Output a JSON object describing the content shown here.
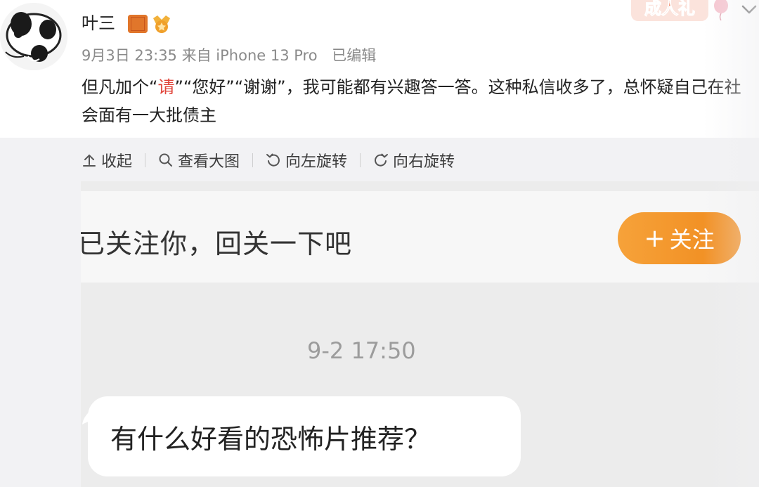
{
  "post": {
    "author": "叶三",
    "date": "9月3日 23:35",
    "source": "来自 iPhone 13 Pro",
    "edited": "已编辑",
    "text_part1": "但凡加个“",
    "text_highlight": "请",
    "text_part2": "”“您好”“谢谢”，我可能都有兴趣答一答。这种私信收多了，总怀疑自己在社会面有一大批债主",
    "promo_label": "成人礼"
  },
  "toolbar": {
    "collapse": "收起",
    "view_large": "查看大图",
    "rotate_left": "向左旋转",
    "rotate_right": "向右旋转"
  },
  "screenshot": {
    "follow_prompt": "已关注你，回关一下吧",
    "follow_button": "关注",
    "follow_plus": "+",
    "timestamp": "9-2 17:50",
    "message": "有什么好看的恐怖片推荐？"
  },
  "colors": {
    "highlight": "#e0443a",
    "follow_button": "#f39328",
    "panel_bg": "#f2f2f4",
    "verified_badge": "#e1762b"
  },
  "icons": [
    "avatar",
    "verified-icon",
    "medal-icon",
    "balloon-icon",
    "chevron-down-icon",
    "collapse-icon",
    "search-icon",
    "rotate-left-icon",
    "rotate-right-icon"
  ]
}
